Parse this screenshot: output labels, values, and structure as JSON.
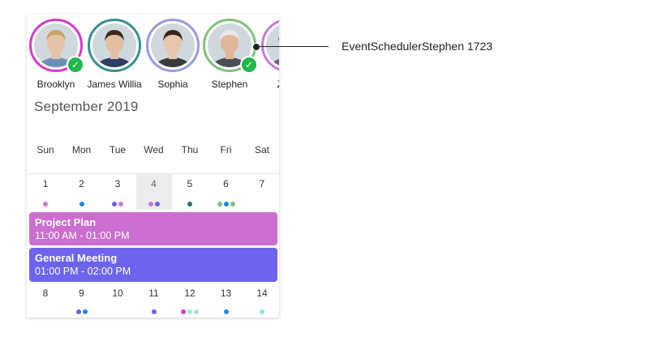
{
  "avatars": [
    {
      "name": "Brooklyn",
      "ring": "#d83ac9",
      "checked": true,
      "skin": "#e7c3a6",
      "hair": "#c9a46a",
      "shirt": "#6c8fb7"
    },
    {
      "name": "James Willia",
      "ring": "#3a8f95",
      "checked": false,
      "skin": "#e2bfa2",
      "hair": "#3a2a20",
      "shirt": "#2c3f63"
    },
    {
      "name": "Sophia",
      "ring": "#9a9ae0",
      "checked": false,
      "skin": "#e8c6ad",
      "hair": "#3b2318",
      "shirt": "#3a3a3a"
    },
    {
      "name": "Stephen",
      "ring": "#80c07a",
      "checked": true,
      "skin": "#e0b79a",
      "hair": "#e8e8e8",
      "shirt": "#4a4f58"
    },
    {
      "name": "Zoey",
      "ring": "#c678d8",
      "checked": false,
      "skin": "#e6c2a8",
      "hair": "#5a3a2a",
      "shirt": "#7a5a8a"
    }
  ],
  "month_title": "September 2019",
  "weekdays": [
    "Sun",
    "Mon",
    "Tue",
    "Wed",
    "Thu",
    "Fri",
    "Sat"
  ],
  "week1": [
    {
      "day": "1",
      "dots": [
        "#c97ad6"
      ]
    },
    {
      "day": "2",
      "dots": [
        "#1e88e5"
      ]
    },
    {
      "day": "3",
      "dots": [
        "#6c63e0",
        "#c97ad6"
      ]
    },
    {
      "day": "4",
      "dots": [
        "#c97ad6",
        "#6c63e0"
      ],
      "today": true
    },
    {
      "day": "5",
      "dots": [
        "#1f7a6e"
      ]
    },
    {
      "day": "6",
      "dots": [
        "#80c07a",
        "#1e88e5",
        "#80c07a"
      ]
    },
    {
      "day": "7",
      "dots": []
    }
  ],
  "week2": [
    {
      "day": "8",
      "dots": []
    },
    {
      "day": "9",
      "dots": [
        "#6c63e0",
        "#1e88e5"
      ]
    },
    {
      "day": "10",
      "dots": []
    },
    {
      "day": "11",
      "dots": [
        "#6c63e0"
      ]
    },
    {
      "day": "12",
      "dots": [
        "#d83ac9",
        "#9fe6e6",
        "#9fe6e6"
      ]
    },
    {
      "day": "13",
      "dots": [
        "#1e88e5"
      ]
    },
    {
      "day": "14",
      "dots": [
        "#7ee6e6"
      ]
    }
  ],
  "events": [
    {
      "title": "Project Plan",
      "time": "11:00 AM - 01:00 PM",
      "color": "#cb6ecf"
    },
    {
      "title": "General Meeting",
      "time": "01:00 PM - 02:00 PM",
      "color": "#6d63ec"
    }
  ],
  "callout": {
    "label": "EventSchedulerStephen 1723"
  }
}
